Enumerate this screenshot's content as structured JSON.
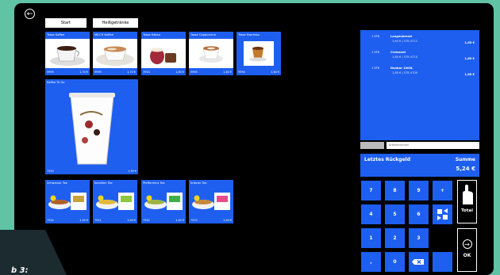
{
  "tabs": [
    "Start",
    "Heißgetränke"
  ],
  "tiles": [
    {
      "name": "Tasse Kaffee",
      "code": "9999",
      "price": "1,70 €",
      "img": "coffee"
    },
    {
      "name": "MILCH Kaffee",
      "code": "9999",
      "price": "1,70 €",
      "img": "latte"
    },
    {
      "name": "Tasse Kakao",
      "code": "7553",
      "price": "1,80 €",
      "img": "kakao"
    },
    {
      "name": "Tasse Cappuccino",
      "code": "9995",
      "price": "1,80 €",
      "img": "cappuccino"
    },
    {
      "name": "Tasse Espresso",
      "code": "9994",
      "price": "1,60 €",
      "img": "espresso"
    }
  ],
  "big_tile": {
    "name": "Kaffee To Go",
    "code": "7553",
    "price": "1,90 €"
  },
  "tea_tiles": [
    {
      "name": "Schwarzer Tee",
      "code": "7524",
      "price": "1,40 €"
    },
    {
      "name": "Kamillen Tee",
      "code": "7521",
      "price": "1,40 €"
    },
    {
      "name": "Pfefferminz Tee",
      "code": "7522",
      "price": "1,40 €"
    },
    {
      "name": "Kräuter Tee",
      "code": "7523",
      "price": "1,40 €"
    }
  ],
  "receipt": [
    {
      "qty": "1 STK",
      "name": "Laugenbrezel",
      "detail": "1,65 € / STK 4711",
      "price": "1,65 €"
    },
    {
      "qty": "1 STK",
      "name": "Croissant",
      "detail": "1,80 € / STK 4710",
      "price": "1,80 €"
    },
    {
      "qty": "1 STK",
      "name": "Donbar 1000L",
      "detail": "1,80 € / STK 4709",
      "price": "1,80 €"
    }
  ],
  "input_placeholder": "Artikelnummer",
  "summary": {
    "label": "Letztes Rückgeld",
    "sum_label": "Summe",
    "sum_value": "5,24 €"
  },
  "keypad": [
    "7",
    "8",
    "9",
    "+",
    "4",
    "5",
    "6",
    "1",
    "2",
    "3",
    ",",
    "0"
  ],
  "buttons": {
    "total": "Total",
    "ok": "OK"
  },
  "corner_text": "b 3:"
}
